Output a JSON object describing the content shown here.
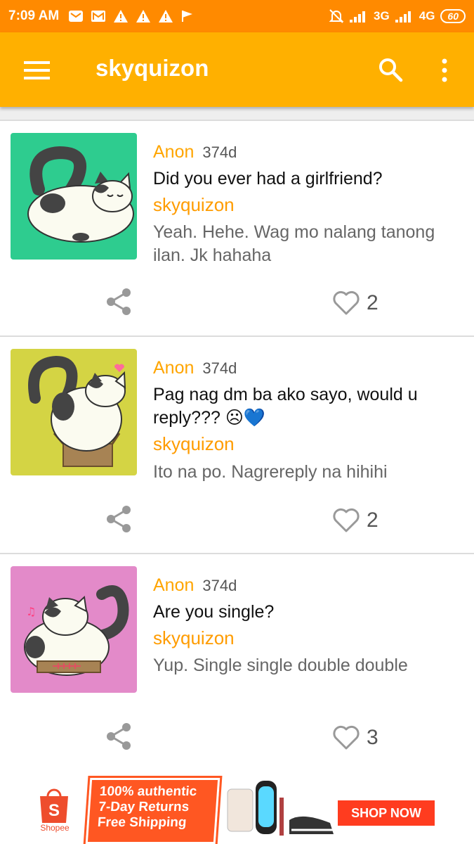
{
  "status_bar": {
    "time": "7:09 AM",
    "network_3g": "3G",
    "network_4g": "4G",
    "battery": "60"
  },
  "app_bar": {
    "title": "skyquizon"
  },
  "colors": {
    "status_bar": "#ff8a00",
    "app_bar": "#ffb000",
    "asker": "#ffa500",
    "answerer": "#ff9c00"
  },
  "posts": [
    {
      "asker": "Anon",
      "age": "374d",
      "question": "Did you ever had a girlfriend?",
      "answerer": "skyquizon",
      "answer": "Yeah. Hehe. Wag mo nalang tanong ilan. Jk hahaha",
      "likes": "2",
      "avatar_color": "#2ecc8f"
    },
    {
      "asker": "Anon",
      "age": "374d",
      "question": "Pag nag dm ba ako sayo, would u reply??? ☹💙",
      "answerer": "skyquizon",
      "answer": "Ito na po. Nagrereply na hihihi",
      "likes": "2",
      "avatar_color": "#d4d444"
    },
    {
      "asker": "Anon",
      "age": "374d",
      "question": "Are you single?",
      "answerer": "skyquizon",
      "answer": "Yup. Single single double double",
      "likes": "3",
      "avatar_color": "#e38ac9"
    }
  ],
  "ad": {
    "brand": "Shopee",
    "promo_lines": [
      "100% authentic",
      "7-Day Returns",
      "Free Shipping"
    ],
    "cta": "SHOP NOW"
  }
}
